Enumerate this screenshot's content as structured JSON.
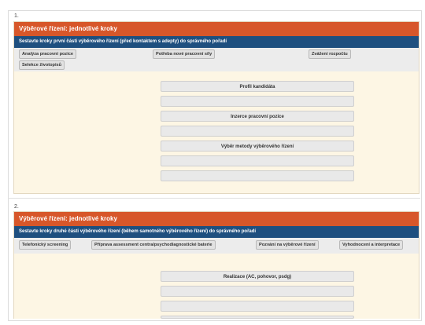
{
  "exercises": [
    {
      "number": "1.",
      "title": "Výběrové řízení: jednotlivé kroky",
      "instruction": "Sestavte kroky první části výběrového řízení (před kontaktem s adepty) do správného pořadí",
      "chips": [
        "Analýza pracovní pozice",
        "Potřeba nové pracovní síly",
        "Zvážení rozpočtu",
        "Selekce životopisů"
      ],
      "slots": [
        "Profil kandidáta",
        "",
        "Inzerce pracovní pozice",
        "",
        "Výběr metody výběrového řízení",
        "",
        ""
      ]
    },
    {
      "number": "2.",
      "title": "Výběrové řízení: jednotlivé kroky",
      "instruction": "Sestavte kroky druhé části výběrového řízení (během samotného výběrového řízení) do správného pořadí",
      "chips": [
        "Telefonický screening",
        "Příprava assessment centra/psychodiagnostické baterie",
        "Pozvání na výběrové řízení",
        "Vyhodnocení a interpretace"
      ],
      "slots": [
        "Realizace (AC, pohovor, psdg)",
        "",
        "",
        ""
      ]
    }
  ]
}
